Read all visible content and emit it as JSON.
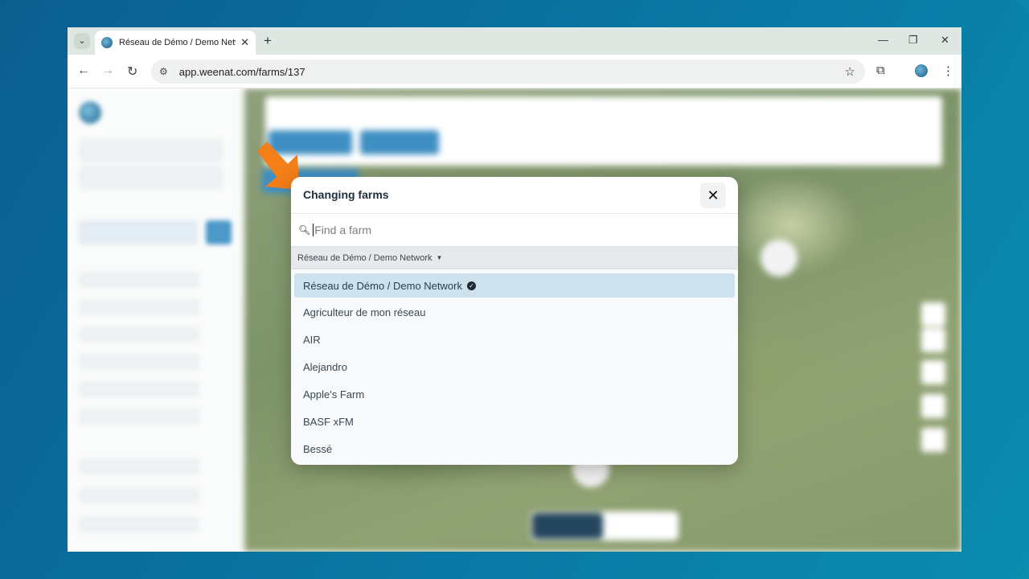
{
  "browser": {
    "tab_title": "Réseau de Démo / Demo Network",
    "new_tab_label": "+",
    "url": "app.weenat.com/farms/137"
  },
  "modal": {
    "title": "Changing farms",
    "close_label": "✕",
    "search_placeholder": "Find a farm",
    "network_selector": "Réseau de Démo / Demo Network",
    "farms": [
      {
        "name": "Réseau de Démo / Demo Network",
        "selected": true,
        "verified": true
      },
      {
        "name": "Agriculteur de mon réseau"
      },
      {
        "name": "AIR"
      },
      {
        "name": "Alejandro"
      },
      {
        "name": "Apple's Farm"
      },
      {
        "name": "BASF xFM"
      },
      {
        "name": "Bessé"
      }
    ]
  },
  "colors": {
    "accent_arrow": "#f47e17",
    "selected_row": "#cde2ec",
    "brand_blue": "#3e8fc3",
    "background_gradient_start": "#0b5f90",
    "background_gradient_end": "#0a8cae"
  }
}
